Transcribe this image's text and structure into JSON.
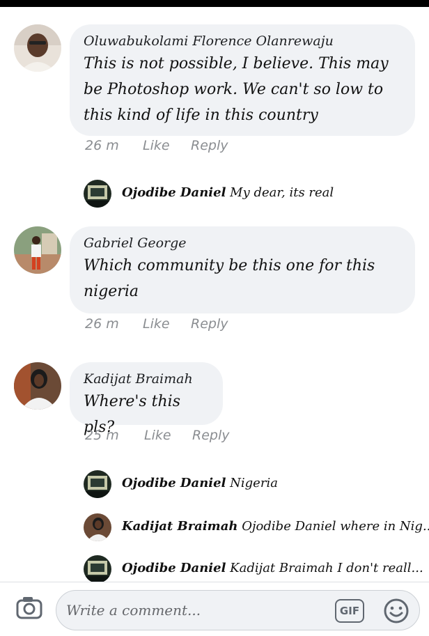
{
  "comments": [
    {
      "author": "Oluwabukolami Florence Olanrewaju",
      "text": "This is not possible, I believe. This may be Photoshop work. We can't so low to this kind of life in this country",
      "time": "26 m",
      "like": "Like",
      "reply": "Reply"
    },
    {
      "author": "Gabriel George",
      "text": "Which community be this one for this nigeria",
      "time": "26 m",
      "like": "Like",
      "reply": "Reply"
    },
    {
      "author": "Kadijat Braimah",
      "text": "Where's this pls?",
      "time": "25 m",
      "like": "Like",
      "reply": "Reply"
    }
  ],
  "replies": [
    {
      "author": "Ojodibe Daniel",
      "text": "My dear, its real"
    },
    {
      "author": "Ojodibe Daniel",
      "text": "Nigeria"
    },
    {
      "author": "Kadijat Braimah",
      "text": "Ojodibe Daniel where in Nig..."
    },
    {
      "author": "Ojodibe Daniel",
      "text": "Kadijat Braimah I don't reall..."
    }
  ],
  "composer": {
    "placeholder": "Write a comment...",
    "gif_label": "GIF",
    "camera_icon": "camera-icon",
    "emoji_icon": "smiley-icon"
  },
  "colors": {
    "bubble": "#f0f2f5",
    "meta": "#8a8d91",
    "text": "#1c1e21"
  }
}
